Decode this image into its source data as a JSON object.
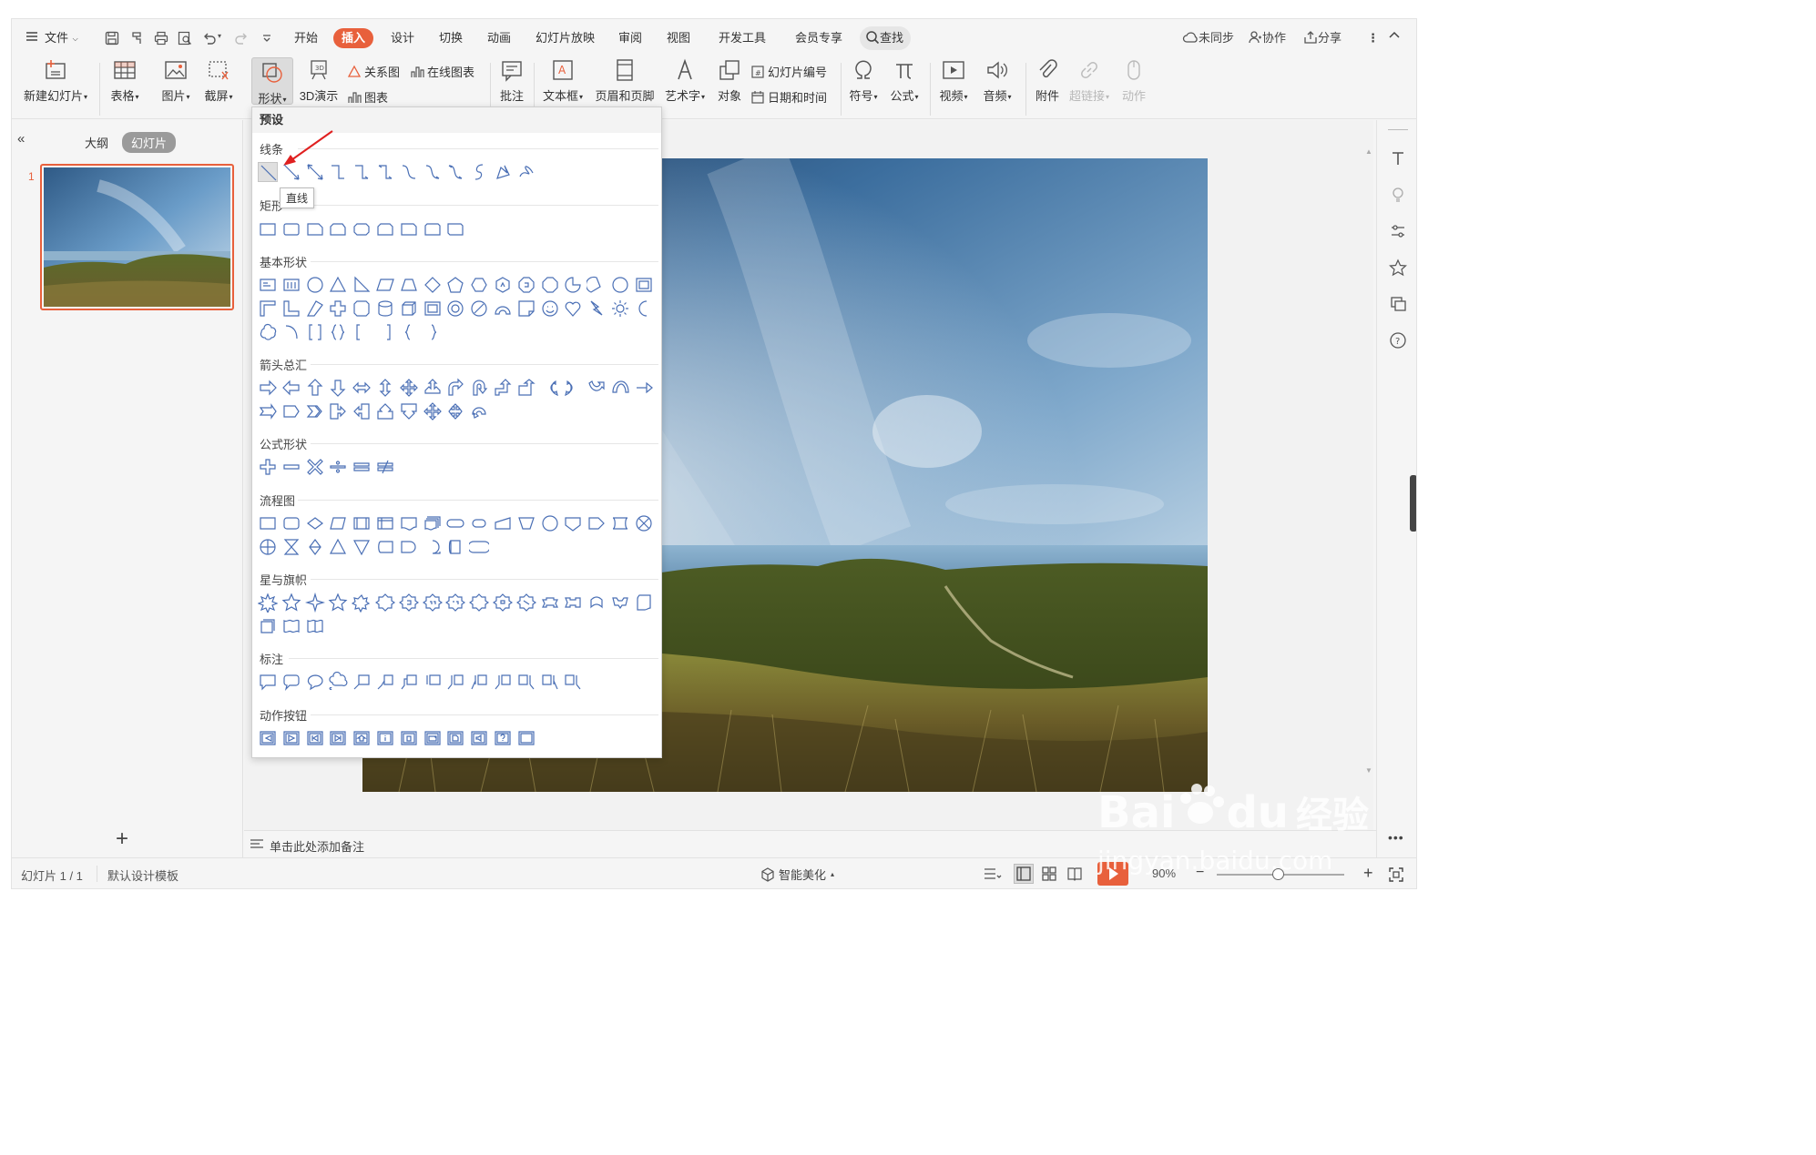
{
  "menu": {
    "file": "文件",
    "tabs": [
      "开始",
      "插入",
      "设计",
      "切换",
      "动画",
      "幻灯片放映",
      "审阅",
      "视图",
      "开发工具",
      "会员专享"
    ],
    "active_tab": "插入",
    "search": "查找",
    "right": {
      "sync": "未同步",
      "collab": "协作",
      "share": "分享"
    }
  },
  "ribbon": {
    "new_slide": "新建幻灯片",
    "table": "表格",
    "picture": "图片",
    "screenshot": "截屏",
    "shape": "形状",
    "demo3d": "3D演示",
    "relation": "关系图",
    "online_chart": "在线图表",
    "chart": "图表",
    "comment": "批注",
    "textbox": "文本框",
    "header_footer": "页眉和页脚",
    "wordart": "艺术字",
    "object": "对象",
    "slide_number": "幻灯片编号",
    "datetime": "日期和时间",
    "symbol": "符号",
    "formula": "公式",
    "video": "视频",
    "audio": "音频",
    "attachment": "附件",
    "hyperlink": "超链接",
    "action": "动作"
  },
  "left_panel": {
    "tab_outline": "大纲",
    "tab_slides": "幻灯片",
    "slide_number": "1",
    "add_label": "+"
  },
  "notes_placeholder": "单击此处添加备注",
  "status": {
    "slide_info": "幻灯片 1 / 1",
    "template": "默认设计模板",
    "beautify": "智能美化",
    "zoom": "90%"
  },
  "shape_menu": {
    "header": "预设",
    "categories": {
      "lines": "线条",
      "rect": "矩形",
      "basic": "基本形状",
      "arrows": "箭头总汇",
      "formula": "公式形状",
      "flowchart": "流程图",
      "stars": "星与旗帜",
      "callouts": "标注",
      "action_buttons": "动作按钮"
    },
    "tooltip": "直线"
  },
  "watermark": {
    "brand": "Bai",
    "brand2": "du",
    "brand_cn": "经验",
    "url": "jingyan.baidu.com"
  },
  "colors": {
    "accent": "#e8603c",
    "shape_stroke": "#4a6fb5",
    "selection": "#e8603c"
  }
}
